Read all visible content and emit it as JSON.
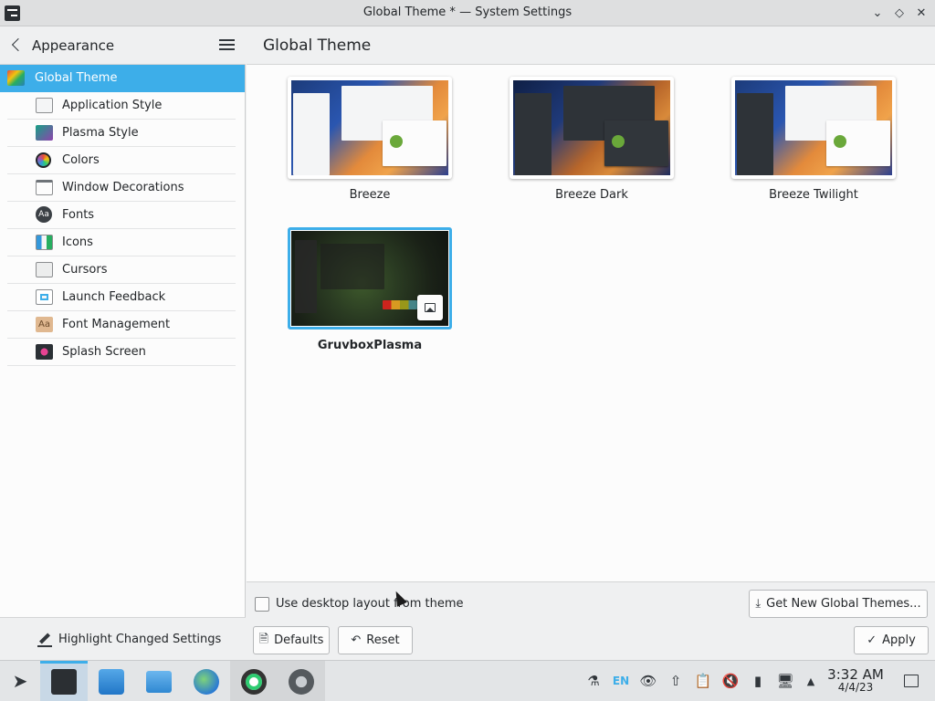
{
  "window": {
    "title": "Global Theme * — System Settings",
    "controls": {
      "minimize": "minimize",
      "maximize": "maximize",
      "close": "close"
    }
  },
  "sidebar": {
    "heading": "Appearance",
    "items": [
      {
        "label": "Global Theme",
        "icon": "global-theme-icon",
        "active": true
      },
      {
        "label": "Application Style",
        "icon": "application-style-icon"
      },
      {
        "label": "Plasma Style",
        "icon": "plasma-style-icon"
      },
      {
        "label": "Colors",
        "icon": "colors-icon"
      },
      {
        "label": "Window Decorations",
        "icon": "window-decorations-icon"
      },
      {
        "label": "Fonts",
        "icon": "fonts-icon"
      },
      {
        "label": "Icons",
        "icon": "icons-icon"
      },
      {
        "label": "Cursors",
        "icon": "cursors-icon"
      },
      {
        "label": "Launch Feedback",
        "icon": "launch-feedback-icon"
      },
      {
        "label": "Font Management",
        "icon": "font-management-icon"
      },
      {
        "label": "Splash Screen",
        "icon": "splash-screen-icon"
      }
    ],
    "footer_label": "Highlight Changed Settings"
  },
  "main": {
    "heading": "Global Theme",
    "themes": [
      {
        "name": "Breeze",
        "style": "light"
      },
      {
        "name": "Breeze Dark",
        "style": "dark"
      },
      {
        "name": "Breeze Twilight",
        "style": "twilight"
      },
      {
        "name": "GruvboxPlasma",
        "style": "gruvbox",
        "selected": true
      }
    ],
    "checkbox_label": "Use desktop layout from theme",
    "checkbox_checked": false,
    "get_new_label": "Get New Global Themes...",
    "defaults_label": "Defaults",
    "reset_label": "Reset",
    "apply_label": "Apply"
  },
  "taskbar": {
    "language": "EN",
    "time": "3:32 AM",
    "date": "4/4/23"
  },
  "colors": {
    "accent": "#3daee9",
    "background": "#eff0f1",
    "surface": "#fcfcfc",
    "text": "#232629"
  }
}
